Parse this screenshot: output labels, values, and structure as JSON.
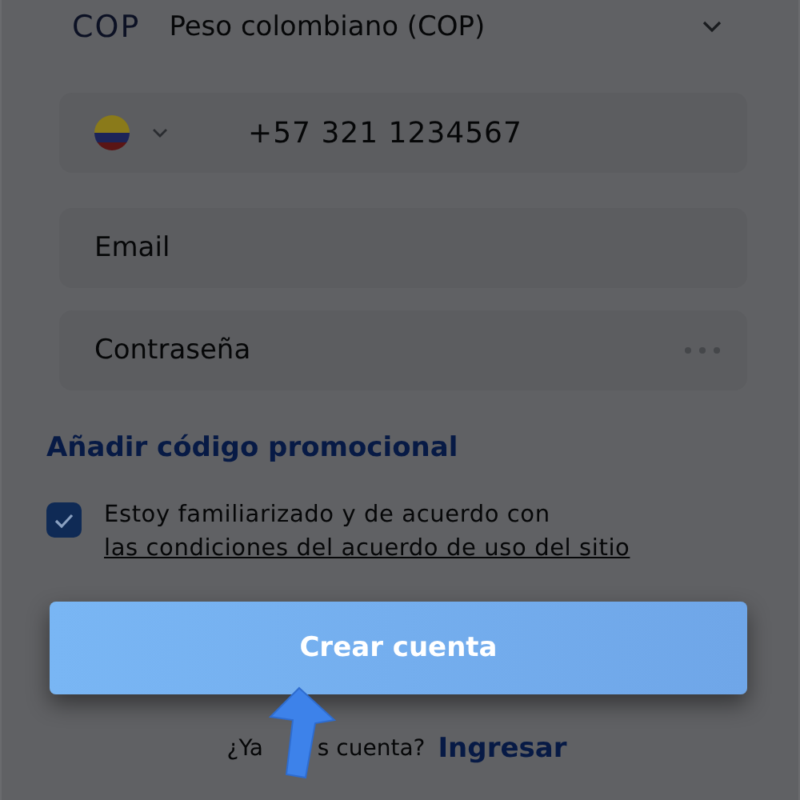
{
  "currency": {
    "code": "COP",
    "name": "Peso colombiano (COP)"
  },
  "phone": {
    "value": "+57 321 1234567"
  },
  "email": {
    "placeholder": "Email"
  },
  "password": {
    "placeholder": "Contraseña"
  },
  "promo_link": "Añadir código promocional",
  "terms": {
    "checked": true,
    "text": "Estoy familiarizado y de acuerdo con ",
    "link": "las condiciones del acuerdo de uso del sitio"
  },
  "submit": "Crear cuenta",
  "login": {
    "prompt_start": "¿Ya",
    "prompt_end": "s cuenta?",
    "link": "Ingresar"
  }
}
